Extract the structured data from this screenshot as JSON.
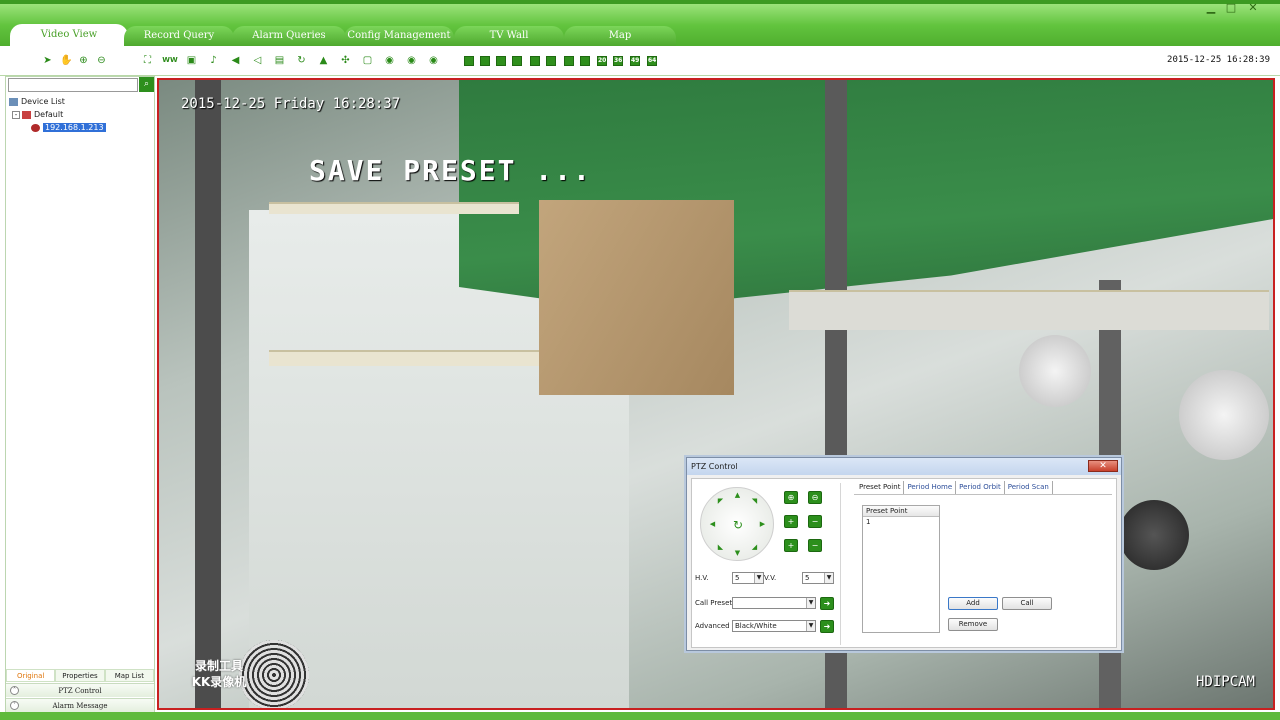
{
  "tabs": [
    {
      "label": "Video View"
    },
    {
      "label": "Record Query"
    },
    {
      "label": "Alarm Queries"
    },
    {
      "label": "Config Management"
    },
    {
      "label": "TV Wall"
    },
    {
      "label": "Map"
    }
  ],
  "toolbar": {
    "datetime": "2015-12-25 16:28:39",
    "layouts": [
      "20",
      "36",
      "49",
      "64"
    ]
  },
  "left_panel": {
    "tree": {
      "root": "Device List",
      "group": "Default",
      "device": "192.168.1.213"
    },
    "tabs": [
      "Original",
      "Properties",
      "Map List"
    ],
    "sections": [
      "PTZ Control",
      "Alarm Message"
    ]
  },
  "video": {
    "osd_time": "2015-12-25 Friday 16:28:37",
    "osd_message": "SAVE PRESET ...",
    "brand": "HDIPCAM",
    "watermark_line1": "录制工具",
    "watermark_line2": "KK录像机"
  },
  "ptz": {
    "title": "PTZ Control",
    "hv_label": "H.V.",
    "hv_value": "5",
    "vv_label": "V.V.",
    "vv_value": "5",
    "call_preset_label": "Call Preset",
    "call_preset_value": "",
    "advanced_label": "Advanced",
    "advanced_value": "Black/White",
    "tabs": [
      "Preset Point",
      "Period Home",
      "Period Orbit",
      "Period Scan"
    ],
    "list_header": "Preset Point",
    "list_items": [
      "1"
    ],
    "add_label": "Add",
    "call_label": "Call",
    "remove_label": "Remove"
  }
}
